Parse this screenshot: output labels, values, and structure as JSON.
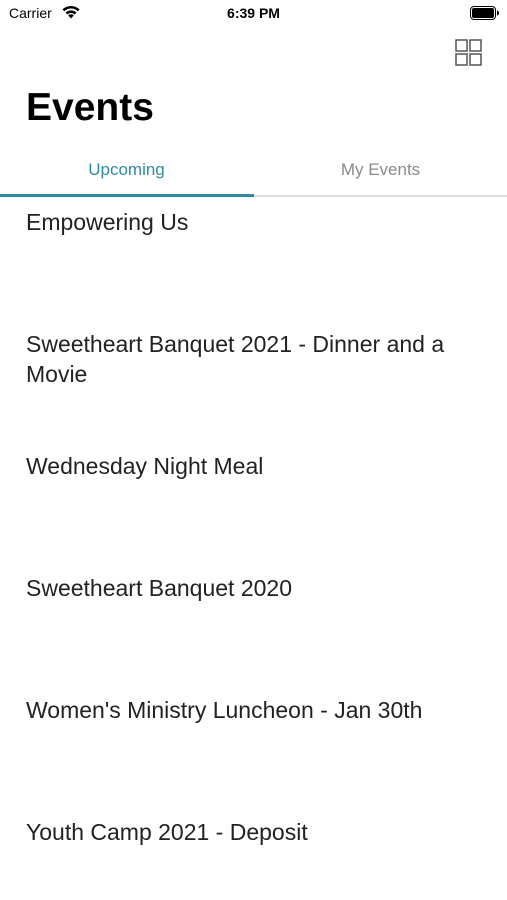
{
  "status_bar": {
    "carrier": "Carrier",
    "time": "6:39 PM"
  },
  "header": {
    "title": "Events",
    "grid_icon": "grid-view-icon"
  },
  "tabs": [
    {
      "label": "Upcoming",
      "selected": true
    },
    {
      "label": "My Events",
      "selected": false
    }
  ],
  "events": [
    {
      "title": "Empowering Us"
    },
    {
      "title": "Sweetheart Banquet 2021 - Dinner and a Movie"
    },
    {
      "title": "Wednesday Night Meal"
    },
    {
      "title": "Sweetheart Banquet 2020"
    },
    {
      "title": "Women's Ministry Luncheon - Jan 30th"
    },
    {
      "title": "Youth Camp 2021 - Deposit"
    }
  ],
  "colors": {
    "accent": "#2f8ba3",
    "inactive_tab": "#8a8a8a",
    "text": "#222222"
  }
}
